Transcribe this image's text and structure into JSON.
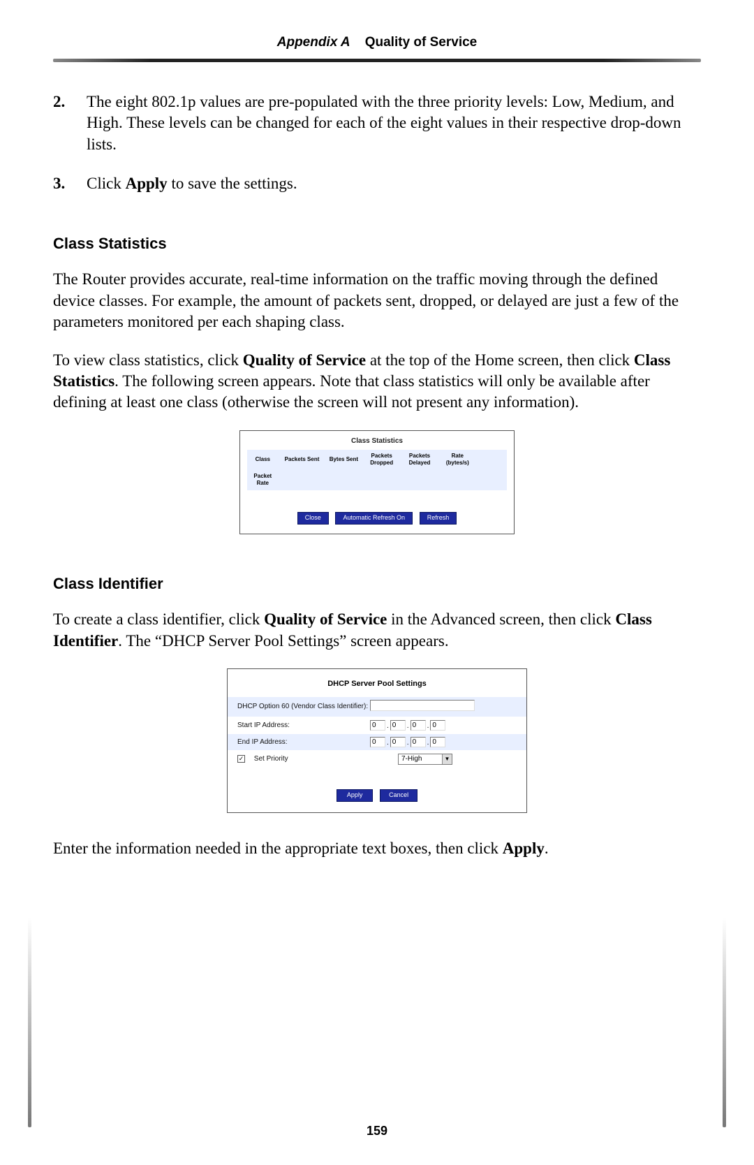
{
  "header": {
    "appendix": "Appendix A",
    "title": "Quality of Service"
  },
  "list": {
    "item2": {
      "num": "2.",
      "text": "The eight 802.1p values are pre-populated with the three priority levels: Low, Medium, and High. These levels can be changed for each of the eight values in their respective drop-down lists."
    },
    "item3": {
      "num": "3.",
      "prefix": "Click ",
      "bold": "Apply",
      "suffix": " to save the settings."
    }
  },
  "class_stats": {
    "heading": "Class Statistics",
    "p1": "The Router provides accurate, real-time information on the traffic moving through the defined device classes. For example, the amount of packets sent, dropped, or delayed are just a few of the parameters monitored per each shaping class.",
    "p2_a": "To view class statistics, click ",
    "p2_b1": "Quality of Service",
    "p2_c": " at the top of the Home screen, then click ",
    "p2_b2": "Class Statistics",
    "p2_d": ". The following screen appears. Note that class statistics will only be available after defining at least one class (otherwise the screen will not present any information).",
    "fig": {
      "title": "Class Statistics",
      "cols": [
        "Class",
        "Packets Sent",
        "Bytes Sent",
        "Packets Dropped",
        "Packets Delayed",
        "Rate (bytes/s)",
        "Packet Rate"
      ],
      "btn_close": "Close",
      "btn_auto": "Automatic Refresh On",
      "btn_refresh": "Refresh"
    }
  },
  "class_id": {
    "heading": "Class Identifier",
    "p1_a": "To create a class identifier, click ",
    "p1_b1": "Quality of Service",
    "p1_c": " in the Advanced screen, then click ",
    "p1_b2": "Class Identifier",
    "p1_d": ". The “DHCP Server Pool Settings” screen appears.",
    "fig": {
      "title": "DHCP Server Pool Settings",
      "opt60": "DHCP Option 60 (Vendor Class Identifier):",
      "start": "Start IP Address:",
      "end": "End IP Address:",
      "priority_label": "Set Priority",
      "priority_value": "7-High",
      "octet": "0",
      "btn_apply": "Apply",
      "btn_cancel": "Cancel"
    },
    "p2_a": "Enter the information needed in the appropriate text boxes, then click ",
    "p2_b": "Apply",
    "p2_c": "."
  },
  "page_number": "159"
}
